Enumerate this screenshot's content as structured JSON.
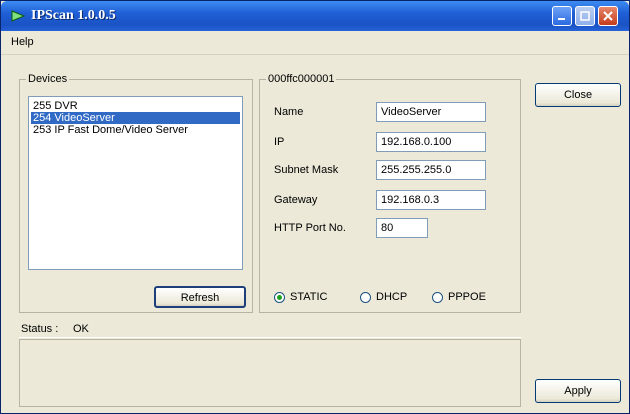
{
  "window": {
    "title": "IPScan 1.0.0.5"
  },
  "menu": {
    "help_label": "Help"
  },
  "devices": {
    "group_label": "Devices",
    "items": [
      {
        "label": "255 DVR"
      },
      {
        "label": "254 VideoServer",
        "selected": true
      },
      {
        "label": "253 IP Fast Dome/Video Server"
      }
    ],
    "refresh_label": "Refresh"
  },
  "device_details": {
    "mac_label": "000ffc000001",
    "fields": {
      "name": {
        "label": "Name",
        "value": "VideoServer"
      },
      "ip": {
        "label": "IP",
        "value": "192.168.0.100"
      },
      "subnet_mask": {
        "label": "Subnet Mask",
        "value": "255.255.255.0"
      },
      "gateway": {
        "label": "Gateway",
        "value": "192.168.0.3"
      },
      "http_port": {
        "label": "HTTP Port No.",
        "value": "80"
      }
    },
    "modes": [
      {
        "label": "STATIC",
        "checked": true
      },
      {
        "label": "DHCP",
        "checked": false
      },
      {
        "label": "PPPOE",
        "checked": false
      }
    ]
  },
  "buttons": {
    "close_label": "Close",
    "apply_label": "Apply"
  },
  "status": {
    "label": "Status :",
    "value": "OK"
  },
  "colors": {
    "titlebar": "#1f5fd6",
    "selection": "#316ac5",
    "face": "#ece9d8"
  }
}
